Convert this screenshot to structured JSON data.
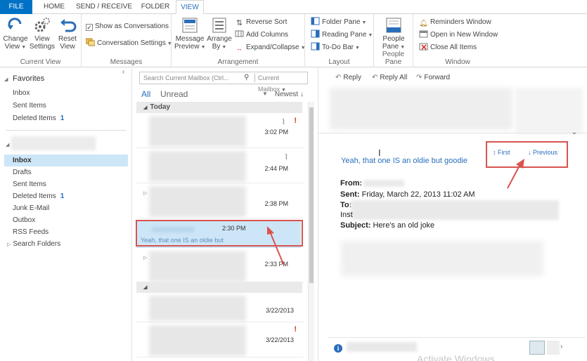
{
  "tabs": [
    "FILE",
    "HOME",
    "SEND / RECEIVE",
    "FOLDER",
    "VIEW"
  ],
  "ribbon": {
    "current_view": {
      "label": "Current View",
      "change_view": [
        "Change",
        "View"
      ],
      "view_settings": [
        "View",
        "Settings"
      ],
      "reset_view": [
        "Reset",
        "View"
      ]
    },
    "messages": {
      "label": "Messages",
      "show_as_conversations": "Show as Conversations",
      "show_as_conversations_checked": true,
      "conversation_settings": "Conversation Settings"
    },
    "arrangement": {
      "label": "Arrangement",
      "message_preview": [
        "Message",
        "Preview"
      ],
      "arrange_by": [
        "Arrange",
        "By"
      ],
      "reverse_sort": "Reverse Sort",
      "add_columns": "Add Columns",
      "expand_collapse": "Expand/Collapse"
    },
    "layout": {
      "label": "Layout",
      "folder_pane": "Folder Pane",
      "reading_pane": "Reading Pane",
      "todo_bar": "To-Do Bar"
    },
    "people_pane": {
      "label": "People Pane",
      "people_pane_btn": [
        "People",
        "Pane"
      ]
    },
    "window": {
      "label": "Window",
      "reminders_window": "Reminders Window",
      "open_new_window": "Open in New Window",
      "close_all_items": "Close All Items"
    }
  },
  "folders": {
    "favorites_header": "Favorites",
    "favorites": [
      {
        "name": "Inbox",
        "count": ""
      },
      {
        "name": "Sent Items",
        "count": ""
      },
      {
        "name": "Deleted Items",
        "count": "1"
      }
    ],
    "mailbox": [
      {
        "name": "Inbox",
        "count": "",
        "selected": true
      },
      {
        "name": "Drafts",
        "count": ""
      },
      {
        "name": "Sent Items",
        "count": ""
      },
      {
        "name": "Deleted Items",
        "count": "1"
      },
      {
        "name": "Junk E-Mail",
        "count": ""
      },
      {
        "name": "Outbox",
        "count": ""
      },
      {
        "name": "RSS Feeds",
        "count": ""
      },
      {
        "name": "Search Folders",
        "count": ""
      }
    ]
  },
  "message_list": {
    "search_placeholder": "Search Current Mailbox (Ctrl...",
    "search_scope": "Current Mailbox",
    "filter_all": "All",
    "filter_unread": "Unread",
    "sort": "Newest",
    "group_today": "Today",
    "items_times": [
      "3:02 PM",
      "2:44 PM",
      "2:38 PM",
      "2:33 PM",
      "3/22/2013",
      "3/22/2013"
    ],
    "selected": {
      "time": "2:30 PM",
      "preview": "Yeah, that one IS an oldie but"
    }
  },
  "reading_pane": {
    "actions": {
      "reply": "Reply",
      "reply_all": "Reply All",
      "forward": "Forward"
    },
    "subject_line": "Yeah, that one IS an oldie but goodie",
    "nav_first": "First",
    "nav_previous": "Previous",
    "from_label": "From:",
    "sent_label": "Sent:",
    "sent_value": "Friday, March 22, 2013 11:02 AM",
    "to_label": "To:",
    "inst_text": "Inst",
    "subject_label": "Subject:",
    "subject_value": "Here's an old joke",
    "watermark": "Activate Windows"
  },
  "colors": {
    "accent": "#2a6ebb",
    "file_tab": "#0072c6",
    "selection": "#cde6f7",
    "annotation_red": "#d9534f",
    "importance_red": "#d32222"
  }
}
